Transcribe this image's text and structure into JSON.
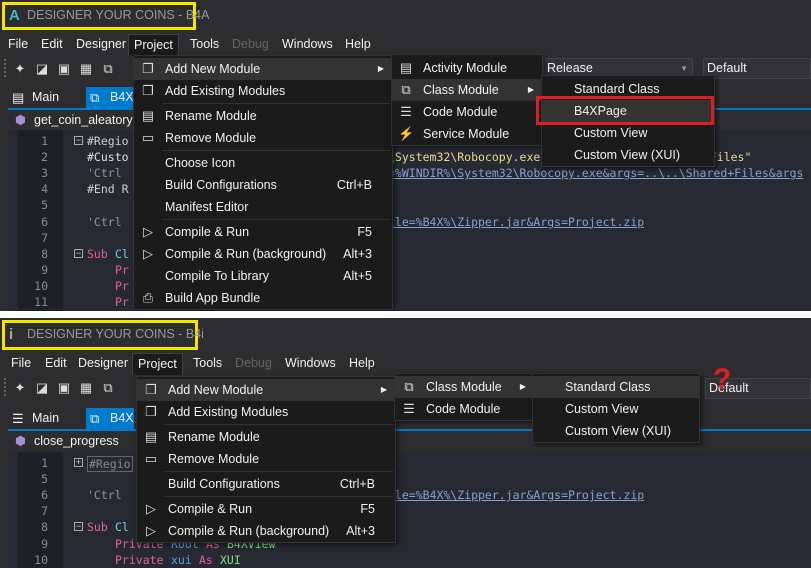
{
  "colors": {
    "highlight_box": "#f5e600",
    "red_marker": "#e21c24",
    "accent_tab": "#007acc",
    "menu_bg": "#1b1b1c"
  },
  "panels": [
    {
      "title": "DESIGNER YOUR COINS - B4A",
      "app_icon": "A",
      "menubar": [
        "File",
        "Edit",
        "Designer",
        "Project",
        "Tools",
        "Debug",
        "Windows",
        "Help"
      ],
      "toolbar_icons": [
        "new-project-icon",
        "open-project-icon",
        "save-icon",
        "save-all-icon",
        "copy-icon"
      ],
      "build_config": "Release",
      "device_config": "Default",
      "tabs": [
        {
          "label": "Main",
          "icon": "designer-module-icon"
        },
        {
          "label": "B4X",
          "icon": "class-module-icon"
        }
      ],
      "subtab": "get_coin_aleatory",
      "project_menu": [
        {
          "label": "Add New Module",
          "icon": "add-new-module-icon",
          "submenu": true,
          "highlighted": true
        },
        {
          "label": "Add Existing Modules",
          "icon": "add-existing-icon"
        },
        {
          "sep": true
        },
        {
          "label": "Rename Module",
          "icon": "rename-icon"
        },
        {
          "label": "Remove Module",
          "icon": "remove-icon"
        },
        {
          "sep": true
        },
        {
          "label": "Choose Icon"
        },
        {
          "label": "Build Configurations",
          "shortcut": "Ctrl+B"
        },
        {
          "label": "Manifest Editor"
        },
        {
          "sep": true
        },
        {
          "label": "Compile & Run",
          "icon": "play-icon",
          "shortcut": "F5"
        },
        {
          "label": "Compile & Run (background)",
          "icon": "play-icon",
          "shortcut": "Alt+3"
        },
        {
          "label": "Compile To Library",
          "shortcut": "Alt+5"
        },
        {
          "label": "Build App Bundle",
          "icon": "bundle-icon"
        }
      ],
      "submenu1": [
        {
          "label": "Activity Module",
          "icon": "activity-module-icon"
        },
        {
          "label": "Class Module",
          "icon": "class-module-icon",
          "submenu": true,
          "highlighted": true
        },
        {
          "label": "Code Module",
          "icon": "code-module-icon"
        },
        {
          "label": "Service Module",
          "icon": "service-module-icon"
        }
      ],
      "submenu2": [
        {
          "label": "Standard Class"
        },
        {
          "label": "B4XPage",
          "highlighted": true,
          "marked": true
        },
        {
          "label": "Custom View"
        },
        {
          "label": "Custom View (XUI)"
        }
      ],
      "code": [
        {
          "n": "1",
          "parts": [
            {
              "t": "#Regio",
              "c": "#cfcfcf"
            }
          ],
          "fold": "minus"
        },
        {
          "n": "2",
          "parts": [
            {
              "t": "#Custo",
              "c": "#e0e0e0"
            },
            {
              "t": "\\System32\\Robocopy.exe",
              "c": "#e6dc8a",
              "col": 43
            },
            {
              "t": ".\\Files\"",
              "c": "#e6dc8a",
              "col": 87
            }
          ]
        },
        {
          "n": "3",
          "parts": [
            {
              "t": "'Ctrl",
              "c": "#8a94a8"
            },
            {
              "t": "=%WINDIR%\\System32\\Robocopy.exe&args=..\\..\\Shared+Files&args",
              "link": true,
              "col": 43
            }
          ]
        },
        {
          "n": "4",
          "parts": [
            {
              "t": "#End R",
              "c": "#cfcfcf"
            }
          ]
        },
        {
          "n": "5",
          "parts": []
        },
        {
          "n": "6",
          "parts": [
            {
              "t": "'Ctrl",
              "c": "#8a94a8"
            },
            {
              "t": "ile=%B4X%\\Zipper.jar&Args=Project.zip",
              "link": true,
              "col": 43
            }
          ]
        },
        {
          "n": "7",
          "parts": []
        },
        {
          "n": "8",
          "parts": [
            {
              "t": "Sub",
              "c": "#e0609a"
            },
            {
              "t": "Cl",
              "c": "#6fd3e8",
              "col": 4
            }
          ],
          "fold": "minus"
        },
        {
          "n": "9",
          "parts": [
            {
              "t": "Pr",
              "c": "#e0609a",
              "col": 4
            }
          ]
        },
        {
          "n": "10",
          "parts": [
            {
              "t": "Pr",
              "c": "#e0609a",
              "col": 4
            }
          ]
        },
        {
          "n": "11",
          "parts": [
            {
              "t": "Pr",
              "c": "#e0609a",
              "col": 4
            }
          ]
        }
      ]
    },
    {
      "title": "DESIGNER YOUR COINS - B4i",
      "app_icon": "i",
      "menubar": [
        "File",
        "Edit",
        "Designer",
        "Project",
        "Tools",
        "Debug",
        "Windows",
        "Help"
      ],
      "toolbar_icons": [
        "new-project-icon",
        "open-project-icon",
        "save-icon",
        "save-all-icon",
        "copy-icon"
      ],
      "device_config": "Default",
      "question_mark": "?",
      "tabs": [
        {
          "label": "Main",
          "icon": "code-module-icon"
        },
        {
          "label": "B4X",
          "icon": "class-module-icon"
        }
      ],
      "subtab": "close_progress",
      "project_menu": [
        {
          "label": "Add New Module",
          "icon": "add-new-module-icon",
          "submenu": true,
          "highlighted": true
        },
        {
          "label": "Add Existing Modules",
          "icon": "add-existing-icon"
        },
        {
          "sep": true
        },
        {
          "label": "Rename Module",
          "icon": "rename-icon"
        },
        {
          "label": "Remove Module",
          "icon": "remove-icon"
        },
        {
          "sep": true
        },
        {
          "label": "Build Configurations",
          "shortcut": "Ctrl+B"
        },
        {
          "sep": true
        },
        {
          "label": "Compile & Run",
          "icon": "play-icon",
          "shortcut": "F5"
        },
        {
          "label": "Compile & Run (background)",
          "icon": "play-icon",
          "shortcut": "Alt+3"
        }
      ],
      "submenu1": [
        {
          "label": "Class Module",
          "icon": "class-module-icon",
          "submenu": true,
          "highlighted": true
        },
        {
          "label": "Code Module",
          "icon": "code-module-icon"
        }
      ],
      "submenu2": [
        {
          "label": "Standard Class",
          "highlighted": true
        },
        {
          "label": "Custom View"
        },
        {
          "label": "Custom View (XUI)"
        }
      ],
      "code": [
        {
          "n": "1",
          "parts": [
            {
              "t": "#Regio",
              "c": "#8a8a8a",
              "box": true
            }
          ],
          "fold": "plus"
        },
        {
          "n": "5",
          "parts": []
        },
        {
          "n": "6",
          "parts": [
            {
              "t": "'Ctrl",
              "c": "#8a94a8"
            },
            {
              "t": "ile=%B4X%\\Zipper.jar&Args=Project.zip",
              "link": true,
              "col": 43
            }
          ]
        },
        {
          "n": "7",
          "parts": []
        },
        {
          "n": "8",
          "parts": [
            {
              "t": "Sub",
              "c": "#e0609a"
            },
            {
              "t": "Cl",
              "c": "#6fd3e8",
              "col": 4
            }
          ],
          "fold": "minus"
        },
        {
          "n": "9",
          "parts": [
            {
              "t": "Private",
              "c": "#e0609a",
              "col": 4
            },
            {
              "t": "Root",
              "c": "#5aa0e6",
              "col": 12
            },
            {
              "t": "As",
              "c": "#e0609a",
              "col": 17
            },
            {
              "t": "B4XView",
              "c": "#7fe07f",
              "col": 20
            }
          ]
        },
        {
          "n": "10",
          "parts": [
            {
              "t": "Private",
              "c": "#e0609a",
              "col": 4
            },
            {
              "t": "xui",
              "c": "#5aa0e6",
              "col": 12
            },
            {
              "t": "As",
              "c": "#e0609a",
              "col": 16
            },
            {
              "t": "XUI",
              "c": "#7fe07f",
              "col": 19
            }
          ]
        }
      ]
    }
  ]
}
